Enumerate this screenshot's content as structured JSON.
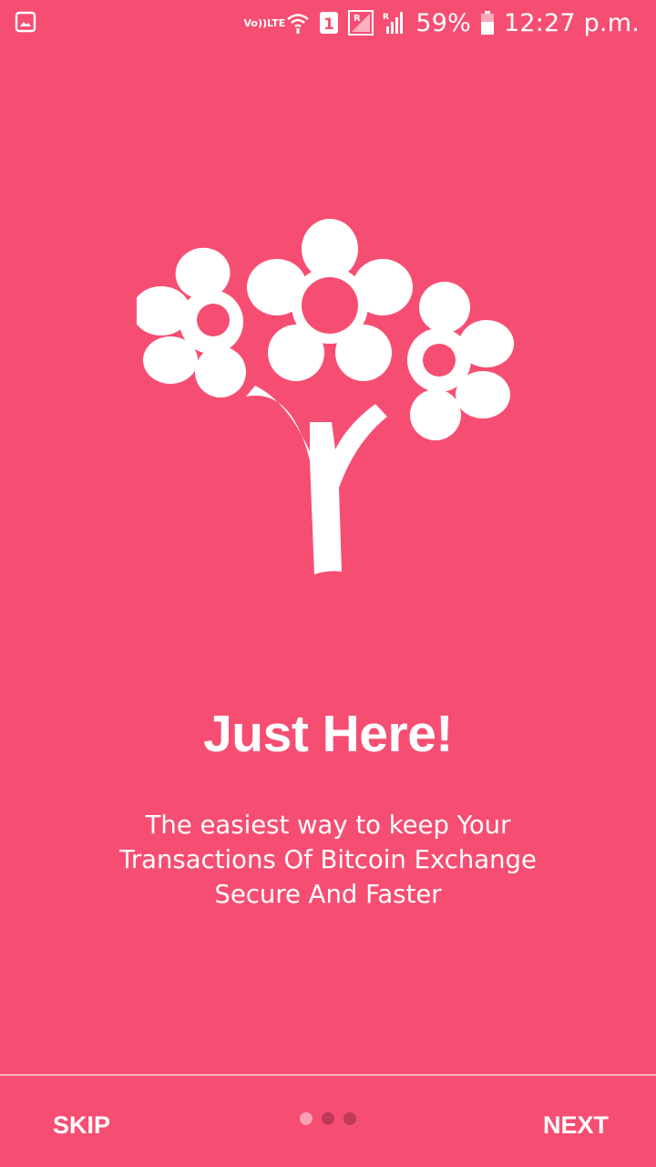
{
  "status_bar": {
    "volte_line1": "Vo))",
    "volte_line2": "LTE",
    "sim_badge": "1",
    "battery_percent": "59%",
    "time": "12:27 p.m.",
    "icons": [
      "gallery-icon",
      "wifi-icon",
      "sim1-icon",
      "signal-roaming-icon",
      "signal-icon",
      "battery-icon"
    ]
  },
  "onboarding": {
    "illustration": "flower-bouquet-icon",
    "title": "Just Here!",
    "description_lines": [
      "The easiest way to keep Your",
      "Transactions Of Bitcoin Exchange",
      "Secure And Faster"
    ],
    "page_indicator": {
      "total": 3,
      "current": 1
    }
  },
  "nav": {
    "skip_label": "SKIP",
    "next_label": "NEXT"
  },
  "colors": {
    "background": "#f64e72",
    "foreground": "#ffffff",
    "dot_active": "#f8a0b6",
    "dot_inactive": "#c13a5a"
  }
}
